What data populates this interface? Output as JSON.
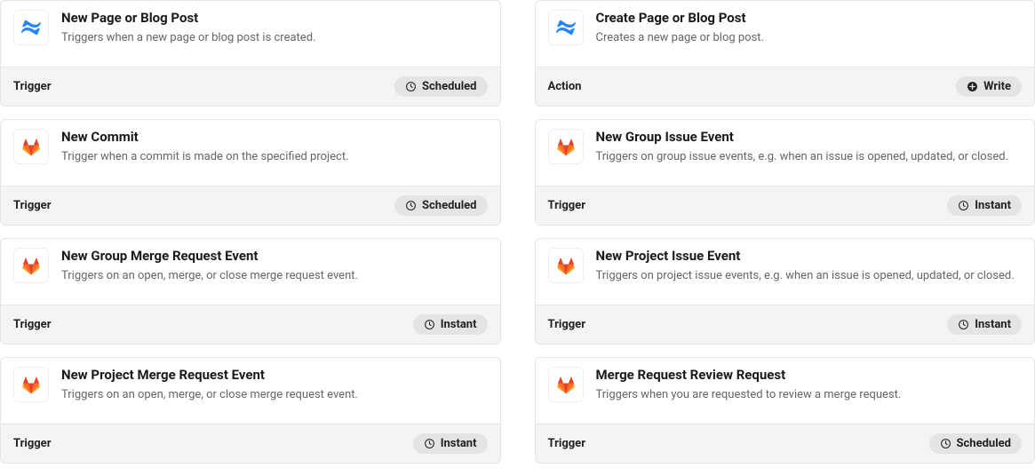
{
  "cards": [
    {
      "icon": "confluence",
      "title": "New Page or Blog Post",
      "desc": "Triggers when a new page or blog post is created.",
      "footerLabel": "Trigger",
      "badge": "Scheduled",
      "badgeIcon": "clock"
    },
    {
      "icon": "confluence",
      "title": "Create Page or Blog Post",
      "desc": "Creates a new page or blog post.",
      "footerLabel": "Action",
      "badge": "Write",
      "badgeIcon": "write"
    },
    {
      "icon": "gitlab",
      "title": "New Commit",
      "desc": "Trigger when a commit is made on the specified project.",
      "footerLabel": "Trigger",
      "badge": "Scheduled",
      "badgeIcon": "clock"
    },
    {
      "icon": "gitlab",
      "title": "New Group Issue Event",
      "desc": "Triggers on group issue events, e.g. when an issue is opened, updated, or closed.",
      "footerLabel": "Trigger",
      "badge": "Instant",
      "badgeIcon": "clock"
    },
    {
      "icon": "gitlab",
      "title": "New Group Merge Request Event",
      "desc": "Triggers on an open, merge, or close merge request event.",
      "footerLabel": "Trigger",
      "badge": "Instant",
      "badgeIcon": "clock"
    },
    {
      "icon": "gitlab",
      "title": "New Project Issue Event",
      "desc": "Triggers on project issue events, e.g. when an issue is opened, updated, or closed.",
      "footerLabel": "Trigger",
      "badge": "Instant",
      "badgeIcon": "clock"
    },
    {
      "icon": "gitlab",
      "title": "New Project Merge Request Event",
      "desc": "Triggers on an open, merge, or close merge request event.",
      "footerLabel": "Trigger",
      "badge": "Instant",
      "badgeIcon": "clock"
    },
    {
      "icon": "gitlab",
      "title": "Merge Request Review Request",
      "desc": "Triggers when you are requested to review a merge request.",
      "footerLabel": "Trigger",
      "badge": "Scheduled",
      "badgeIcon": "clock"
    }
  ]
}
